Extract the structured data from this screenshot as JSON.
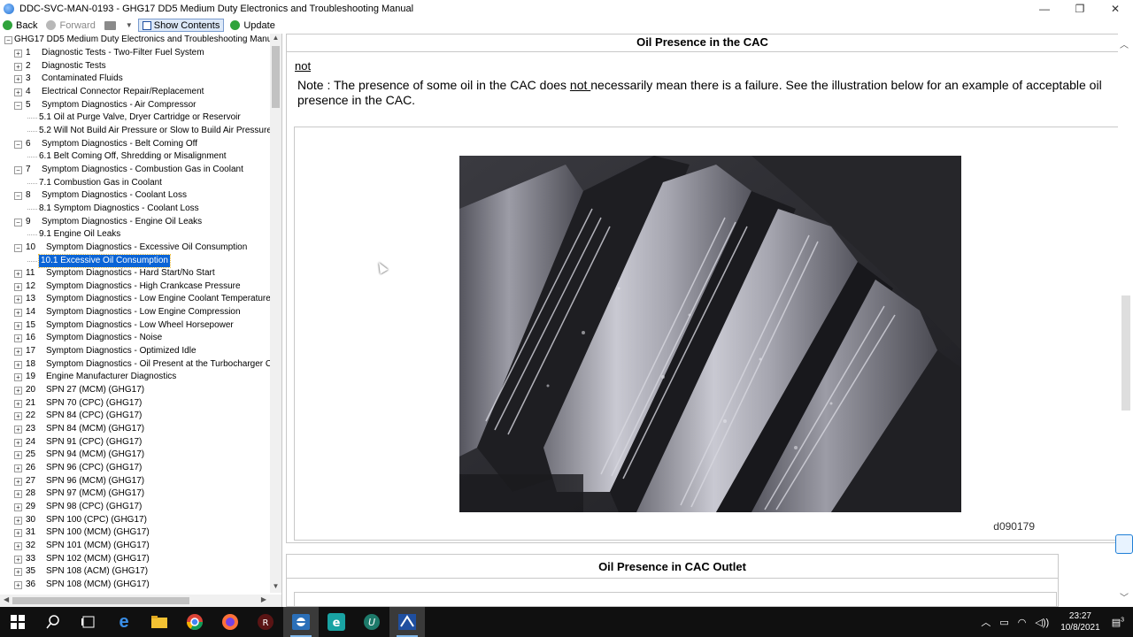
{
  "window": {
    "title": "DDC-SVC-MAN-0193 - GHG17 DD5 Medium Duty Electronics and Troubleshooting Manual",
    "minimize": "—",
    "maximize": "❐",
    "close": "✕"
  },
  "toolbar": {
    "back": "Back",
    "forward": "Forward",
    "show_contents": "Show Contents",
    "update": "Update"
  },
  "tree": {
    "root": "GHG17 DD5 Medium Duty Electronics and Troubleshooting Manu",
    "items": [
      {
        "num": "1",
        "label": "Diagnostic Tests - Two-Filter Fuel System",
        "level": 1
      },
      {
        "num": "2",
        "label": "Diagnostic Tests",
        "level": 1
      },
      {
        "num": "3",
        "label": "Contaminated Fluids",
        "level": 1
      },
      {
        "num": "4",
        "label": "Electrical Connector Repair/Replacement",
        "level": 1
      },
      {
        "num": "5",
        "label": "Symptom Diagnostics - Air Compressor",
        "level": 1,
        "open": true
      },
      {
        "num": "",
        "label": "5.1 Oil at Purge Valve, Dryer Cartridge or Reservoir",
        "level": 2
      },
      {
        "num": "",
        "label": "5.2 Will Not Build Air Pressure or Slow to Build Air Pressure",
        "level": 2
      },
      {
        "num": "6",
        "label": "Symptom Diagnostics - Belt Coming Off",
        "level": 1,
        "open": true
      },
      {
        "num": "",
        "label": "6.1 Belt Coming Off, Shredding or Misalignment",
        "level": 2
      },
      {
        "num": "7",
        "label": "Symptom Diagnostics - Combustion Gas in Coolant",
        "level": 1,
        "open": true
      },
      {
        "num": "",
        "label": "7.1 Combustion Gas in Coolant",
        "level": 2
      },
      {
        "num": "8",
        "label": "Symptom Diagnostics - Coolant Loss",
        "level": 1,
        "open": true
      },
      {
        "num": "",
        "label": "8.1 Symptom Diagnostics - Coolant Loss",
        "level": 2
      },
      {
        "num": "9",
        "label": "Symptom Diagnostics - Engine Oil Leaks",
        "level": 1,
        "open": true
      },
      {
        "num": "",
        "label": "9.1 Engine Oil Leaks",
        "level": 2
      },
      {
        "num": "10",
        "label": "Symptom Diagnostics - Excessive Oil Consumption",
        "level": 1,
        "open": true
      },
      {
        "num": "",
        "label": "10.1 Excessive Oil Consumption",
        "level": 2,
        "selected": true
      },
      {
        "num": "11",
        "label": "Symptom Diagnostics - Hard Start/No Start",
        "level": 1
      },
      {
        "num": "12",
        "label": "Symptom Diagnostics - High Crankcase Pressure",
        "level": 1
      },
      {
        "num": "13",
        "label": "Symptom Diagnostics - Low Engine Coolant Temperature",
        "level": 1
      },
      {
        "num": "14",
        "label": "Symptom Diagnostics - Low Engine Compression",
        "level": 1
      },
      {
        "num": "15",
        "label": "Symptom Diagnostics - Low Wheel Horsepower",
        "level": 1
      },
      {
        "num": "16",
        "label": "Symptom Diagnostics - Noise",
        "level": 1
      },
      {
        "num": "17",
        "label": "Symptom Diagnostics - Optimized Idle",
        "level": 1
      },
      {
        "num": "18",
        "label": "Symptom Diagnostics - Oil Present at the Turbocharger C",
        "level": 1
      },
      {
        "num": "19",
        "label": "Engine Manufacturer Diagnostics",
        "level": 1
      },
      {
        "num": "20",
        "label": "SPN 27 (MCM) (GHG17)",
        "level": 1
      },
      {
        "num": "21",
        "label": "SPN 70 (CPC) (GHG17)",
        "level": 1
      },
      {
        "num": "22",
        "label": "SPN 84 (CPC) (GHG17)",
        "level": 1
      },
      {
        "num": "23",
        "label": "SPN 84 (MCM) (GHG17)",
        "level": 1
      },
      {
        "num": "24",
        "label": "SPN 91 (CPC) (GHG17)",
        "level": 1
      },
      {
        "num": "25",
        "label": "SPN 94 (MCM) (GHG17)",
        "level": 1
      },
      {
        "num": "26",
        "label": "SPN 96 (CPC) (GHG17)",
        "level": 1
      },
      {
        "num": "27",
        "label": "SPN 96 (MCM) (GHG17)",
        "level": 1
      },
      {
        "num": "28",
        "label": "SPN 97 (MCM) (GHG17)",
        "level": 1
      },
      {
        "num": "29",
        "label": "SPN 98 (CPC) (GHG17)",
        "level": 1
      },
      {
        "num": "30",
        "label": "SPN 100 (CPC) (GHG17)",
        "level": 1
      },
      {
        "num": "31",
        "label": "SPN 100 (MCM) (GHG17)",
        "level": 1
      },
      {
        "num": "32",
        "label": "SPN 101 (MCM) (GHG17)",
        "level": 1
      },
      {
        "num": "33",
        "label": "SPN 102 (MCM) (GHG17)",
        "level": 1
      },
      {
        "num": "35",
        "label": "SPN 108 (ACM) (GHG17)",
        "level": 1
      },
      {
        "num": "36",
        "label": "SPN 108 (MCM) (GHG17)",
        "level": 1
      }
    ]
  },
  "content": {
    "section1_title": "Oil Presence in the CAC",
    "not_word": "not",
    "note_prefix": "Note : The presence of some oil in the CAC does ",
    "note_underlined": "not ",
    "note_suffix": "necessarily mean there is a failure. See the illustration below for an example of acceptable oil presence in the CAC.",
    "figure_id": "d090179",
    "section2_title": "Oil Presence in CAC Outlet"
  },
  "taskbar": {
    "time": "23:27",
    "date": "10/8/2021",
    "notif_count": "3"
  }
}
